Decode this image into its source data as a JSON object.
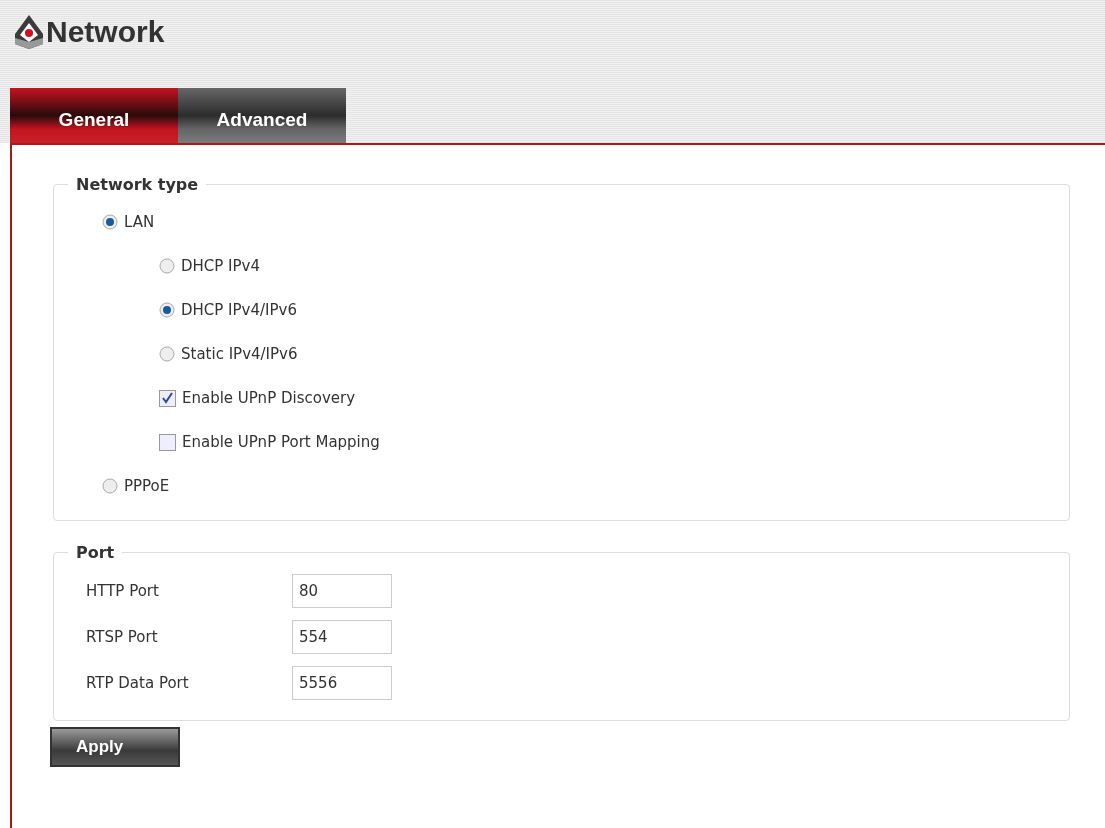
{
  "page": {
    "title": "Network"
  },
  "tabs": [
    {
      "label": "General",
      "selected": true
    },
    {
      "label": "Advanced",
      "selected": false
    }
  ],
  "network_type": {
    "legend": "Network type",
    "options": [
      {
        "kind": "radio",
        "label": "LAN",
        "selected": true,
        "children": [
          {
            "kind": "radio",
            "label": "DHCP IPv4",
            "selected": false
          },
          {
            "kind": "radio",
            "label": "DHCP IPv4/IPv6",
            "selected": true
          },
          {
            "kind": "radio",
            "label": "Static IPv4/IPv6",
            "selected": false
          },
          {
            "kind": "checkbox",
            "label": "Enable UPnP Discovery",
            "checked": true
          },
          {
            "kind": "checkbox",
            "label": "Enable UPnP Port Mapping",
            "checked": false
          }
        ]
      },
      {
        "kind": "radio",
        "label": "PPPoE",
        "selected": false
      }
    ]
  },
  "port": {
    "legend": "Port",
    "fields": [
      {
        "label": "HTTP Port",
        "value": "80"
      },
      {
        "label": "RTSP Port",
        "value": "554"
      },
      {
        "label": "RTP Data Port",
        "value": "5556"
      }
    ]
  },
  "buttons": [
    "Apply"
  ]
}
